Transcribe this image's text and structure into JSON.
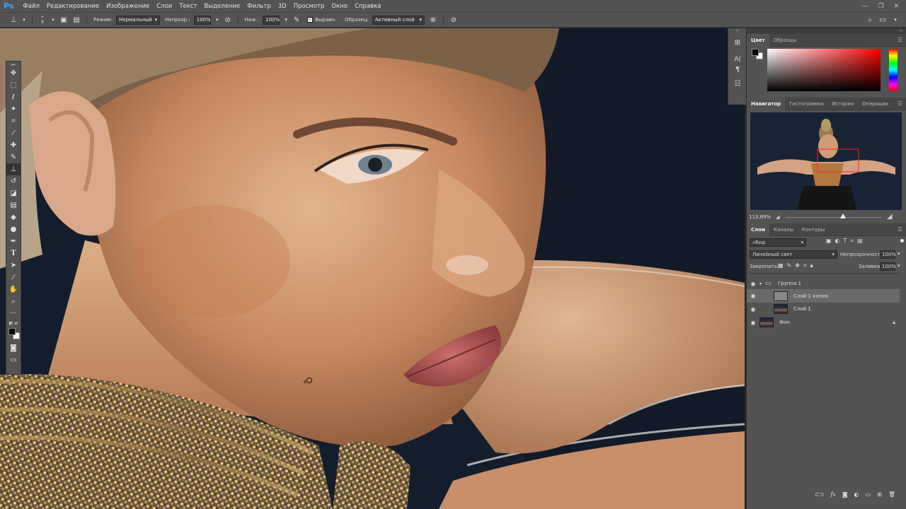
{
  "app": {
    "logo": "Ps"
  },
  "menu": [
    "Файл",
    "Редактирование",
    "Изображение",
    "Слои",
    "Текст",
    "Выделение",
    "Фильтр",
    "3D",
    "Просмотр",
    "Окно",
    "Справка"
  ],
  "options": {
    "brush_size": "9",
    "mode_label": "Режим:",
    "mode_value": "Нормальный",
    "opacity_label": "Непрозр.:",
    "opacity_value": "100%",
    "flow_label": "Наж.:",
    "flow_value": "100%",
    "aligned_label": "Выравн.",
    "sample_label": "Образец:",
    "sample_value": "Активный слой"
  },
  "color_panel": {
    "tabs": [
      "Цвет",
      "Образцы"
    ],
    "accent": "#ff0000"
  },
  "navigator": {
    "tabs": [
      "Навигатор",
      "Гистограмма",
      "История",
      "Операции"
    ],
    "zoom": "113,69%",
    "zoom_level": 0.6
  },
  "layers_panel": {
    "tabs": [
      "Слои",
      "Каналы",
      "Контуры"
    ],
    "filter_value": "Вид",
    "blend_mode": "Линейный свет",
    "opacity_label": "Непрозрачность:",
    "opacity_value": "100%",
    "lock_label": "Закрепить:",
    "fill_label": "Заливка:",
    "fill_value": "100%",
    "layers": [
      {
        "name": "Группа 1",
        "type": "group"
      },
      {
        "name": "Слой 1 копия",
        "type": "layer",
        "selected": true
      },
      {
        "name": "Слой 1",
        "type": "layer"
      },
      {
        "name": "Фон",
        "type": "background",
        "locked": true
      }
    ]
  }
}
